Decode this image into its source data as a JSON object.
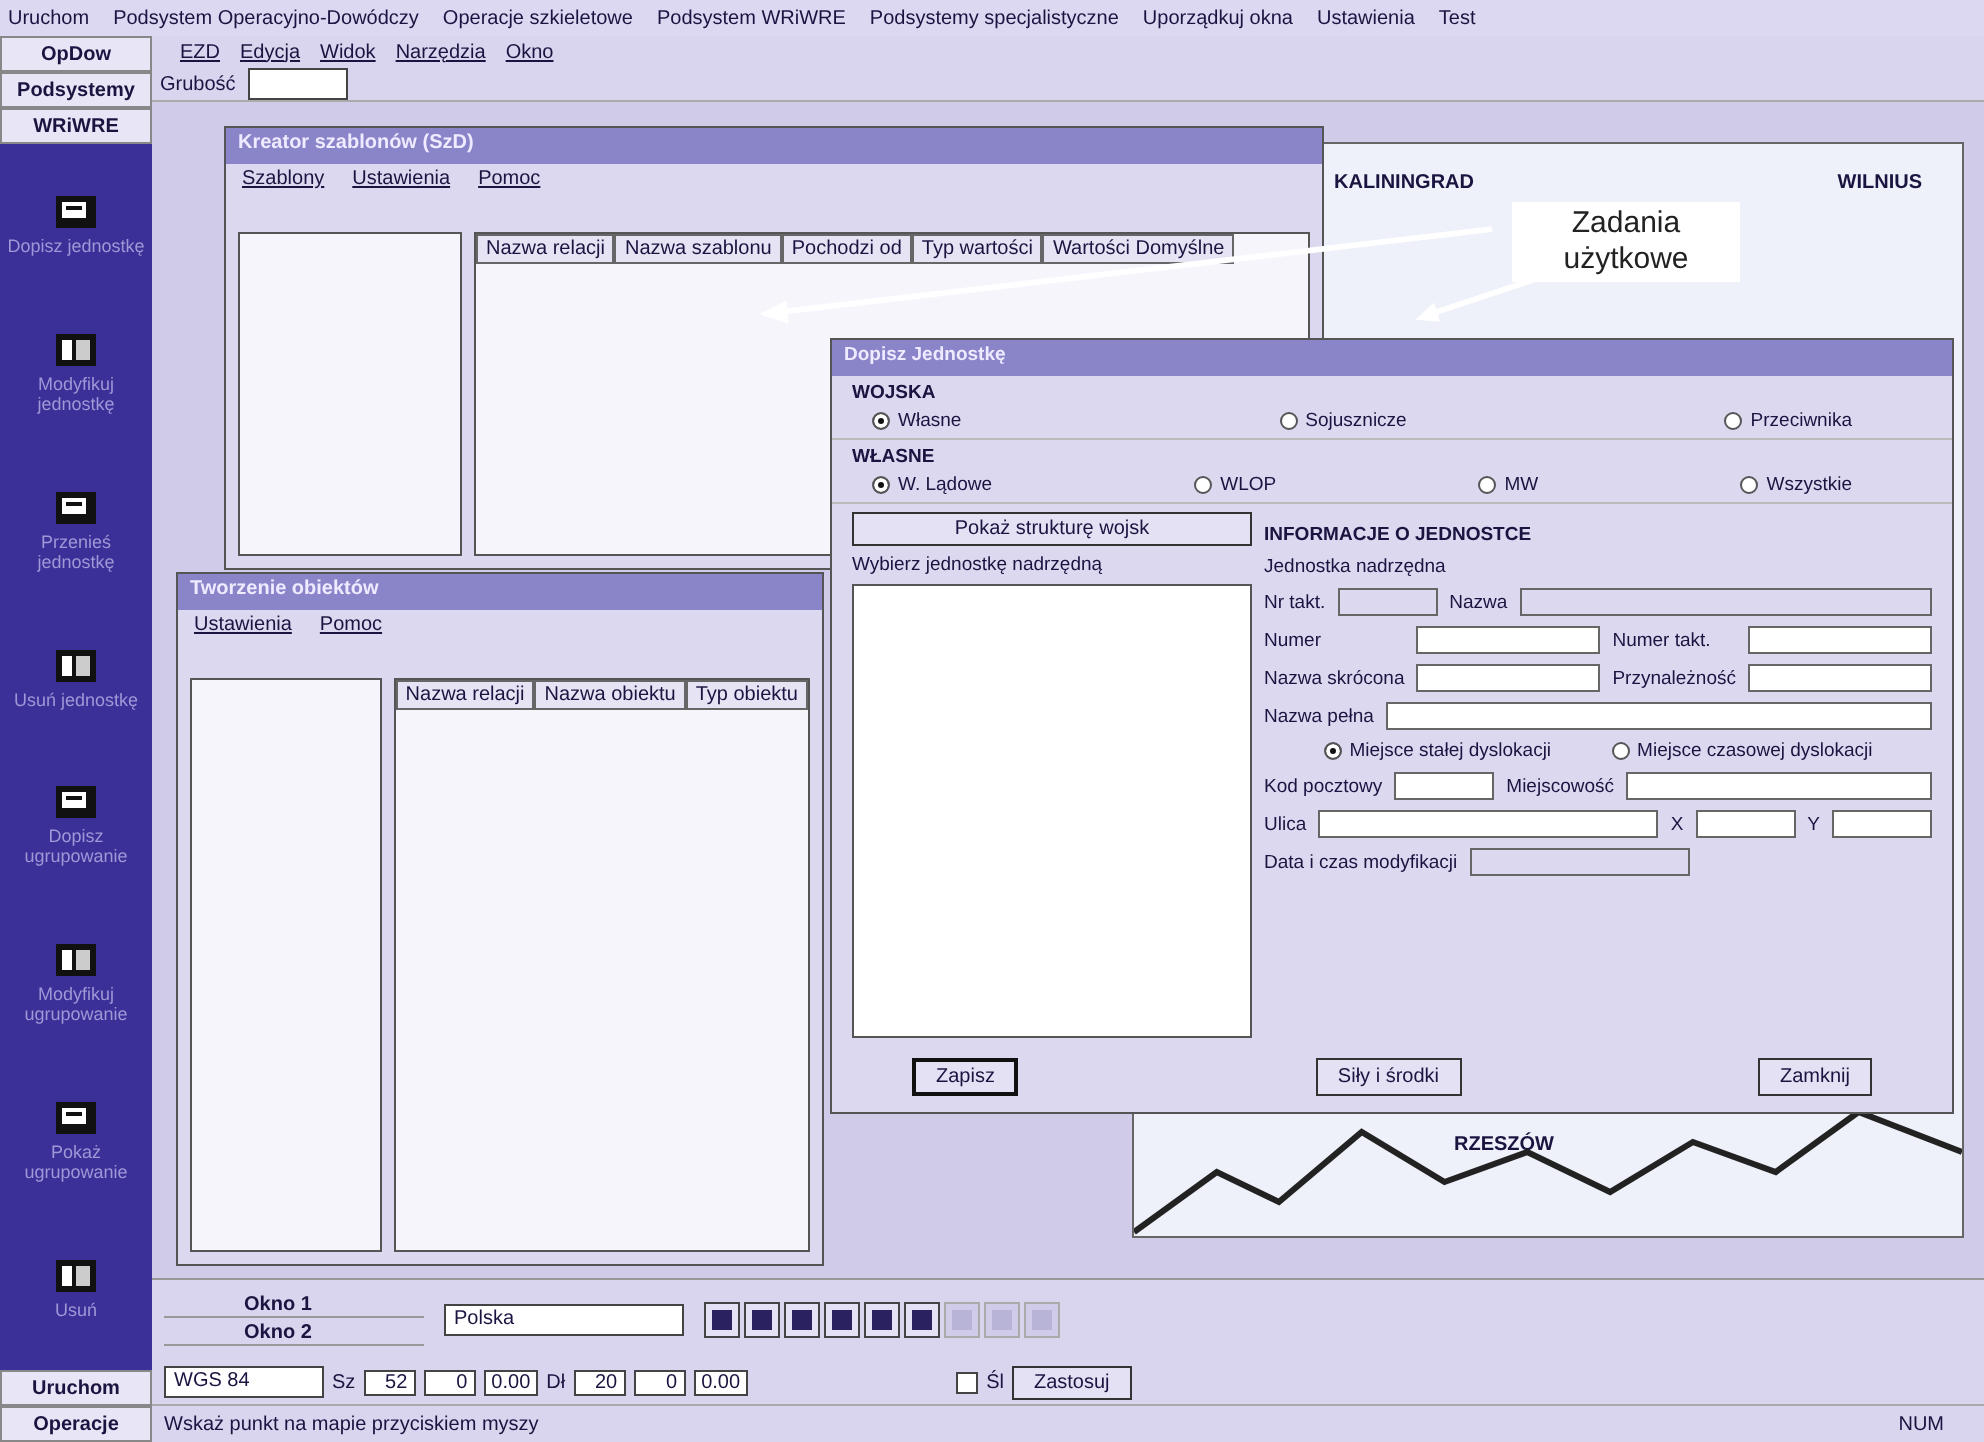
{
  "menu_bar": [
    "Uruchom",
    "Podsystem Operacyjno-Dowódczy",
    "Operacje szkieletowe",
    "Podsystem WRiWRE",
    "Podsystemy specjalistyczne",
    "Uporządkuj okna",
    "Ustawienia",
    "Test"
  ],
  "sidebar": {
    "tabs": [
      "OpDow",
      "Podsystemy",
      "WRiWRE"
    ],
    "tools": [
      {
        "label": "Dopisz jednostkę",
        "kind": "card"
      },
      {
        "label": "Modyfikuj jednostkę",
        "kind": "book"
      },
      {
        "label": "Przenieś jednostkę",
        "kind": "card"
      },
      {
        "label": "Usuń jednostkę",
        "kind": "book"
      },
      {
        "label": "Dopisz ugrupowanie",
        "kind": "card"
      },
      {
        "label": "Modyfikuj ugrupowanie",
        "kind": "book"
      },
      {
        "label": "Pokaż ugrupowanie",
        "kind": "card"
      },
      {
        "label": "Usuń",
        "kind": "book"
      }
    ],
    "bottom_tabs": [
      "Uruchom",
      "Operacje"
    ]
  },
  "app_menu": [
    "EZD",
    "Edycja",
    "Widok",
    "Narzędzia",
    "Okno"
  ],
  "toolbar_label": "Grubość",
  "map": {
    "labels": [
      "KALININGRAD",
      "WILNIUS",
      "RZESZÓW"
    ]
  },
  "callout": {
    "text": "Zadania użytkowe"
  },
  "template_window": {
    "title": "Kreator szablonów (SzD)",
    "menu": [
      "Szablony",
      "Ustawienia",
      "Pomoc"
    ],
    "columns": [
      "Nazwa relacji",
      "Nazwa szablonu",
      "Pochodzi od",
      "Typ wartości",
      "Wartości Domyślne"
    ]
  },
  "object_window": {
    "title": "Tworzenie obiektów",
    "menu": [
      "Ustawienia",
      "Pomoc"
    ],
    "columns": [
      "Nazwa relacji",
      "Nazwa obiektu",
      "Typ obiektu"
    ]
  },
  "dialog": {
    "title": "Dopisz Jednostkę",
    "forces": {
      "label": "WOJSKA",
      "options": [
        {
          "label": "Własne",
          "selected": true
        },
        {
          "label": "Sojusznicze",
          "selected": false
        },
        {
          "label": "Przeciwnika",
          "selected": false
        }
      ]
    },
    "own": {
      "label": "WŁASNE",
      "options": [
        {
          "label": "W. Lądowe",
          "selected": true
        },
        {
          "label": "WLOP",
          "selected": false
        },
        {
          "label": "MW",
          "selected": false
        },
        {
          "label": "Wszystkie",
          "selected": false
        }
      ]
    },
    "structure_button": "Pokaż strukturę wojsk",
    "parent_label": "Wybierz jednostkę nadrzędną",
    "info_title": "INFORMACJE O JEDNOSTCE",
    "parent_group": "Jednostka nadrzędna",
    "parent_fields": [
      "Nr takt.",
      "Nazwa"
    ],
    "fields": [
      "Numer",
      "Numer takt.",
      "Nazwa skrócona",
      "Przynależność"
    ],
    "full_name": "Nazwa pełna",
    "location": {
      "options": [
        {
          "label": "Miejsce stałej dyslokacji",
          "selected": true
        },
        {
          "label": "Miejsce czasowej dyslokacji",
          "selected": false
        }
      ]
    },
    "address": [
      "Kod pocztowy",
      "Miejscowość"
    ],
    "street": [
      "Ulica",
      "X",
      "Y"
    ],
    "modified": "Data i czas modyfikacji",
    "buttons": [
      "Zapisz",
      "Siły i środki",
      "Zamknij"
    ]
  },
  "windows": [
    "Okno 1",
    "Okno 2"
  ],
  "region_combo": "Polska",
  "tool_buttons": [
    {
      "disabled": false
    },
    {
      "disabled": false
    },
    {
      "disabled": false
    },
    {
      "disabled": false
    },
    {
      "disabled": false
    },
    {
      "disabled": false
    },
    {
      "disabled": true
    },
    {
      "disabled": true
    },
    {
      "disabled": true
    }
  ],
  "coords": {
    "datum": "WGS 84",
    "lat_label": "Sz",
    "lat": [
      "52",
      "0",
      "0.00"
    ],
    "lon_label": "Dł",
    "lon": [
      "20",
      "0",
      "0.00"
    ],
    "check_label": "Śl",
    "checked": false,
    "apply": "Zastosuj"
  },
  "status": {
    "hint": "Wskaż punkt na mapie przyciskiem myszy",
    "mode": "NUM"
  }
}
